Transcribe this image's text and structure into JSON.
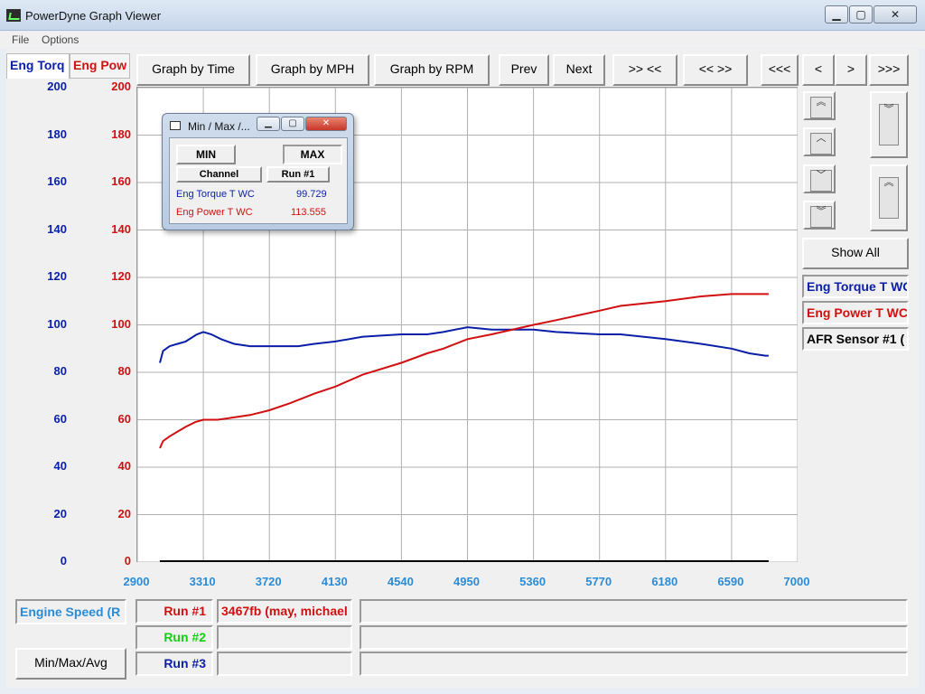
{
  "window": {
    "title": "PowerDyne Graph Viewer",
    "minimize": "▁",
    "maximize": "▢",
    "close": "✕"
  },
  "menu": [
    "File",
    "Options"
  ],
  "channel_tabs": [
    {
      "label": "Eng Torq",
      "color": "#0a1ea8"
    },
    {
      "label": "Eng Pow",
      "color": "#d01010"
    }
  ],
  "toolbar": {
    "graph_by_time": "Graph by Time",
    "graph_by_mph": "Graph by MPH",
    "graph_by_rpm": "Graph by RPM",
    "prev": "Prev",
    "next": "Next",
    "zoom_in": ">> <<",
    "zoom_out": "<< >>",
    "first": "<<<",
    "left": "<",
    "right": ">",
    "last": ">>>"
  },
  "side_buttons": {
    "page_up": "︽",
    "up": "︿",
    "down": "﹀",
    "page_down": "︾",
    "show_all": "Show All"
  },
  "legend": [
    {
      "label": "Eng Torque T WC",
      "color": "#0a1ea8"
    },
    {
      "label": "Eng Power T WC",
      "color": "#d01010"
    },
    {
      "label": "AFR Sensor #1 (",
      "color": "#000000"
    }
  ],
  "popup": {
    "title": "Min / Max /...",
    "min_button": "MIN",
    "max_button": "MAX",
    "col_channel": "Channel",
    "col_run": "Run #1",
    "rows": [
      {
        "channel": "Eng Torque T WC",
        "value": "99.729",
        "color": "#0a1ea8"
      },
      {
        "channel": "Eng Power T WC",
        "value": "113.555",
        "color": "#d01010"
      }
    ]
  },
  "bottom": {
    "xaxis_channel": "Engine Speed (R",
    "runs": [
      {
        "label": "Run #1",
        "color": "#d01010",
        "info": "3467fb (may, michael"
      },
      {
        "label": "Run #2",
        "color": "#10d010",
        "info": ""
      },
      {
        "label": "Run #3",
        "color": "#0a1ea8",
        "info": ""
      }
    ],
    "minmax_button": "Min/Max/Avg"
  },
  "chart_data": {
    "type": "line",
    "x_ticks": [
      2900,
      3310,
      3720,
      4130,
      4540,
      4950,
      5360,
      5770,
      6180,
      6590,
      7000
    ],
    "xlim": [
      2900,
      7000
    ],
    "y_ticks": [
      0,
      20,
      40,
      60,
      80,
      100,
      120,
      140,
      160,
      180,
      200
    ],
    "ylim": [
      0,
      200
    ],
    "grid": true,
    "series": [
      {
        "name": "Eng Torque T WC",
        "color": "#0a1ea8",
        "x": [
          3040,
          3060,
          3100,
          3150,
          3200,
          3270,
          3310,
          3360,
          3420,
          3500,
          3600,
          3720,
          3800,
          3900,
          4000,
          4130,
          4300,
          4540,
          4700,
          4800,
          4950,
          5100,
          5360,
          5500,
          5770,
          5900,
          6180,
          6400,
          6590,
          6700,
          6800,
          6820
        ],
        "y": [
          84,
          89,
          91,
          92,
          93,
          96,
          97,
          96,
          94,
          92,
          91,
          91,
          91,
          91,
          92,
          93,
          95,
          96,
          96,
          97,
          99,
          98,
          98,
          97,
          96,
          96,
          94,
          92,
          90,
          88,
          87,
          87
        ]
      },
      {
        "name": "Eng Power T WC",
        "color": "#d01010",
        "x": [
          3040,
          3060,
          3100,
          3150,
          3200,
          3260,
          3310,
          3400,
          3500,
          3600,
          3720,
          3850,
          4000,
          4130,
          4300,
          4540,
          4700,
          4800,
          4950,
          5100,
          5360,
          5500,
          5770,
          5900,
          6180,
          6400,
          6590,
          6700,
          6800,
          6820
        ],
        "y": [
          48,
          51,
          53,
          55,
          57,
          59,
          60,
          60,
          61,
          62,
          64,
          67,
          71,
          74,
          79,
          84,
          88,
          90,
          94,
          96,
          100,
          102,
          106,
          108,
          110,
          112,
          113,
          113,
          113,
          113
        ]
      }
    ]
  }
}
